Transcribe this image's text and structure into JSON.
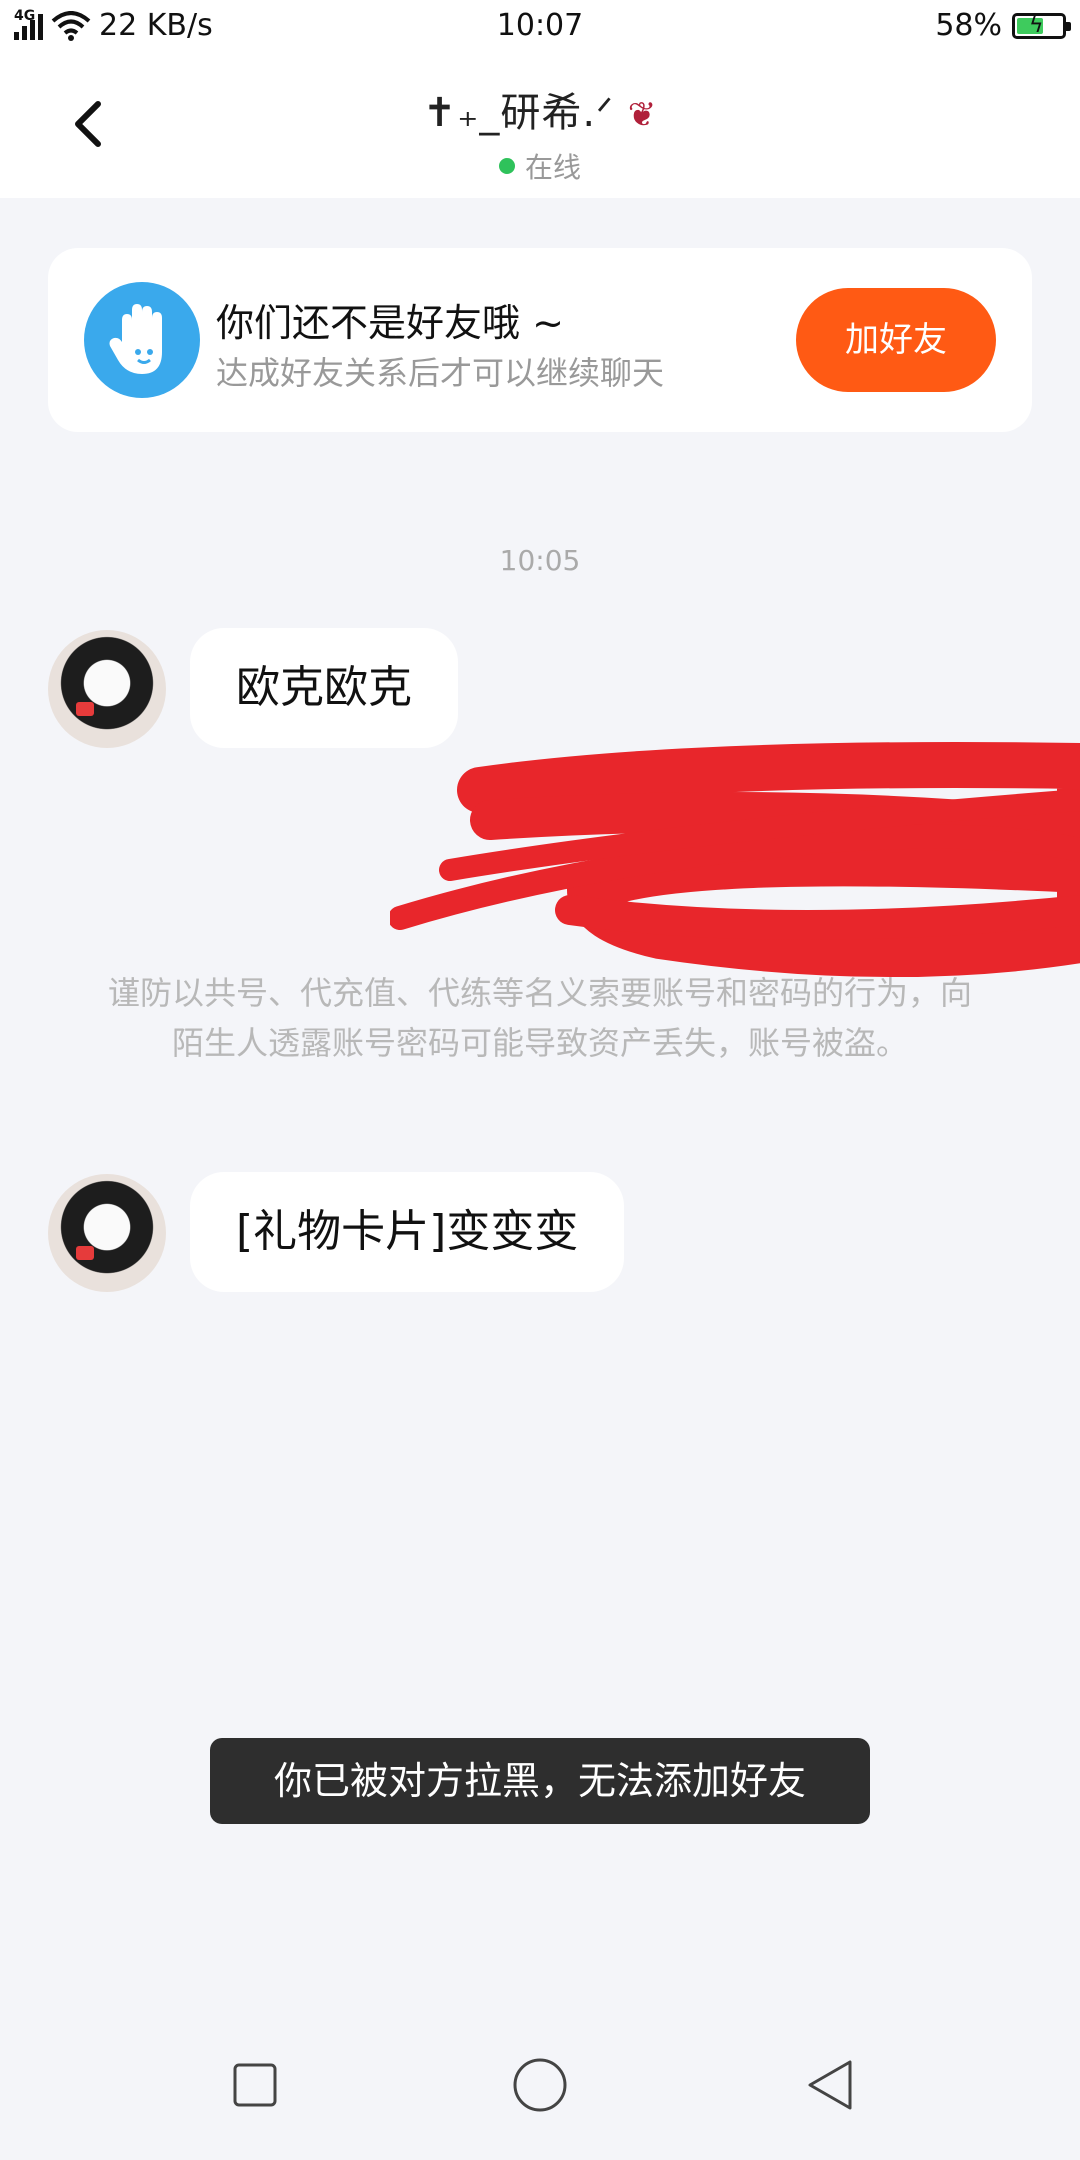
{
  "status_bar": {
    "network": "4G",
    "speed": "22 KB/s",
    "time": "10:07",
    "battery": "58%",
    "battery_level": 0.58,
    "icons": [
      "signal-icon",
      "wifi-icon",
      "battery-icon"
    ]
  },
  "header": {
    "back_icon": "chevron-left-icon",
    "title": "✝₊_研希.ᐟ",
    "title_decoration": "rose-icon",
    "status": "在线"
  },
  "friend_card": {
    "icon": "waving-hand-icon",
    "title": "你们还不是好友哦 ~",
    "subtitle": "达成好友关系后才可以继续聊天",
    "button_label": "加好友",
    "button_color": "#ff5a14"
  },
  "chat": {
    "timestamp": "10:05",
    "messages": [
      {
        "text": "欧克欧克"
      },
      {
        "text": "[礼物卡片]变变变"
      }
    ],
    "warning": "谨防以共号、代充值、代练等名义索要账号和密码的行为，向陌生人透露账号密码可能导致资产丢失，账号被盗。"
  },
  "toast": {
    "text": "你已被对方拉黑，无法添加好友"
  },
  "nav_bar": {
    "icons": [
      "recent-apps-icon",
      "home-icon",
      "back-triangle-icon"
    ]
  },
  "colors": {
    "accent": "#ff5a14",
    "online": "#2fc25b",
    "hand_icon_bg": "#3aa9ec",
    "redaction": "#e8262b"
  }
}
